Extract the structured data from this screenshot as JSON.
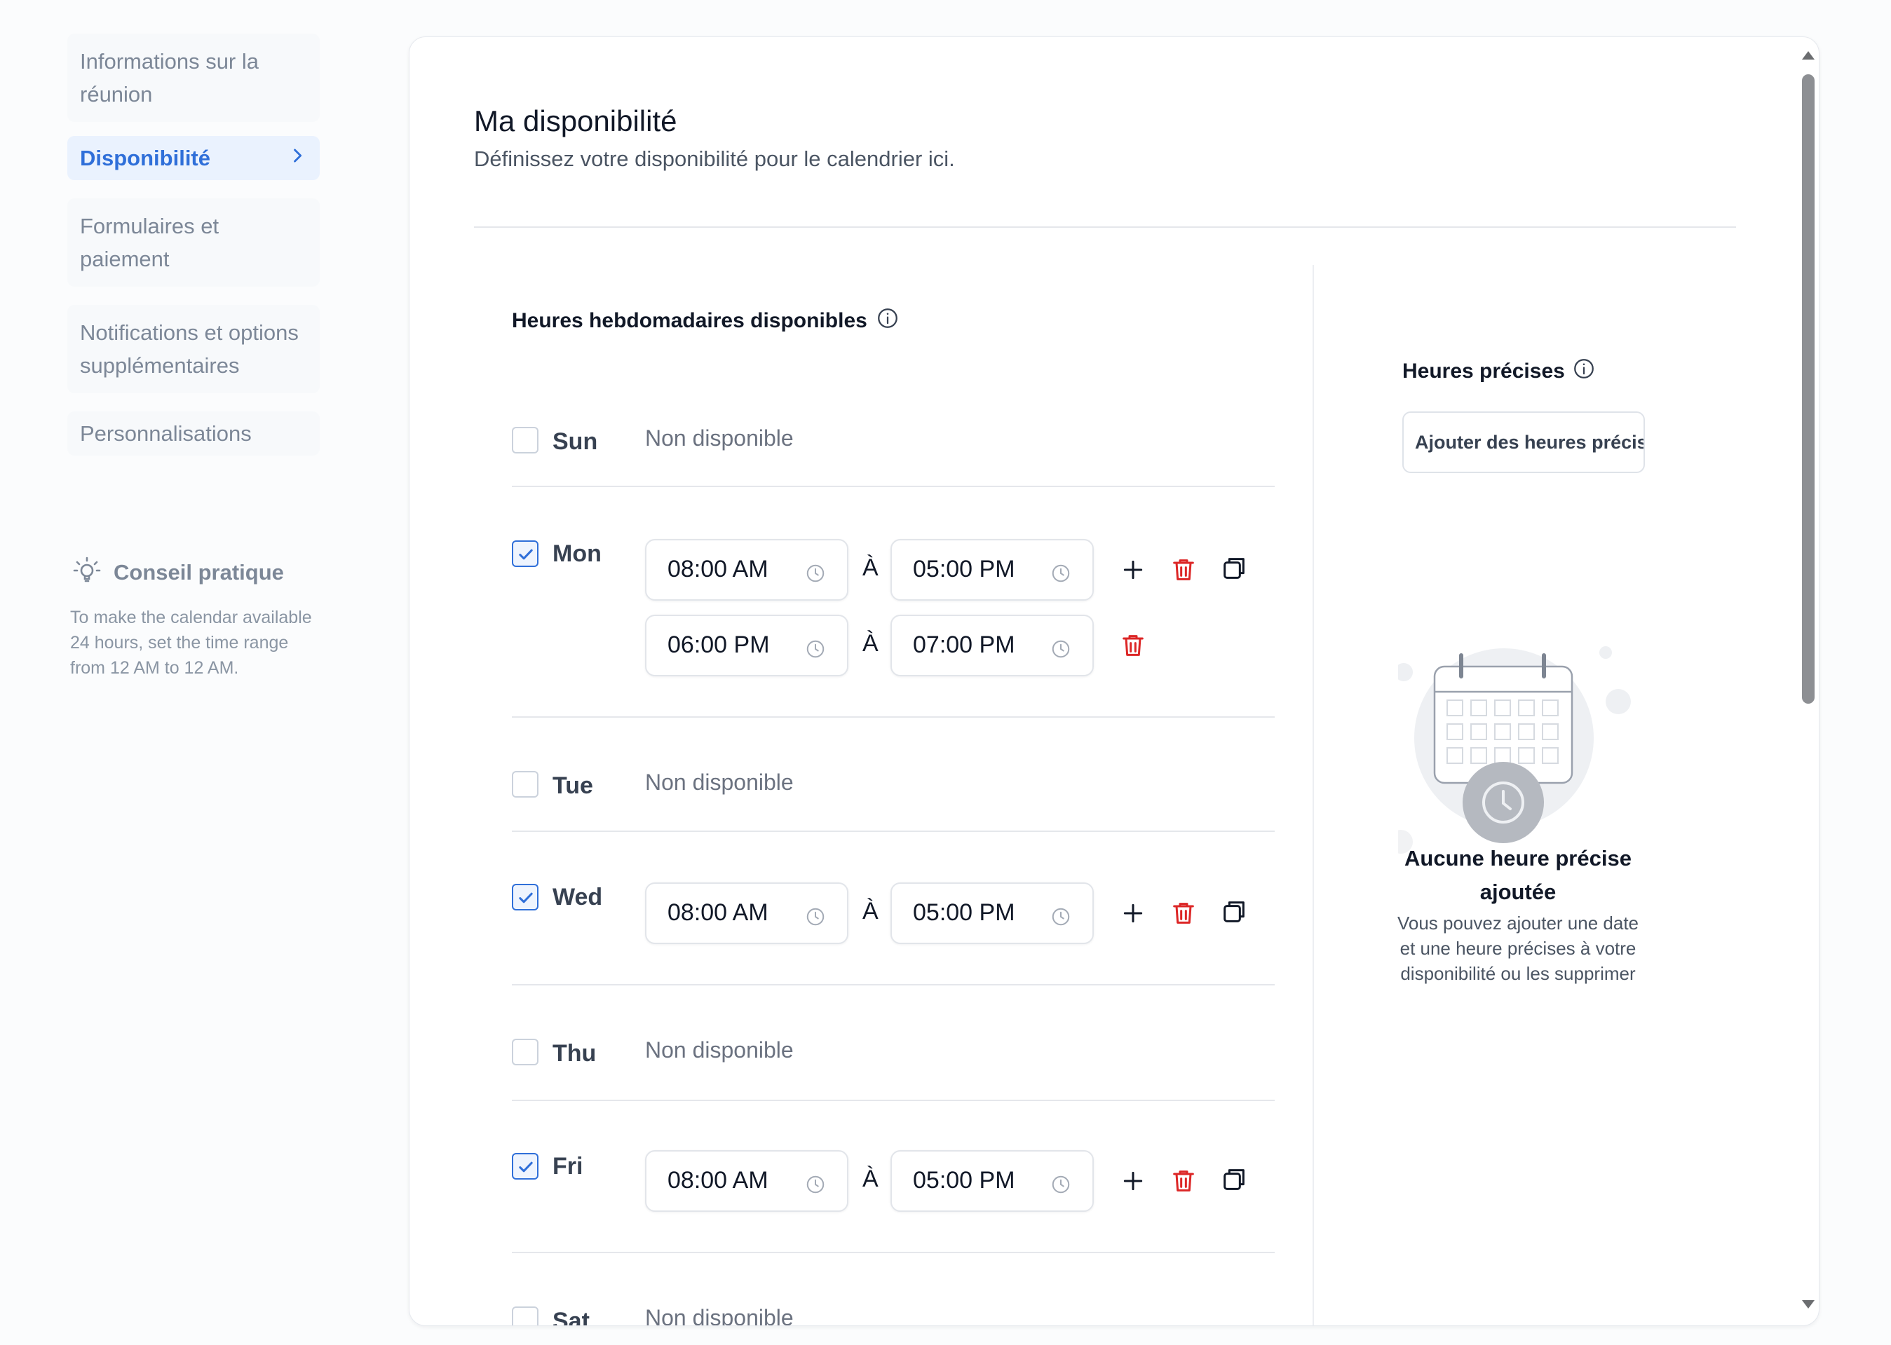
{
  "sidebar": {
    "items": [
      {
        "label": "Informations sur la réunion"
      },
      {
        "label": "Disponibilité"
      },
      {
        "label": "Formulaires et paiement"
      },
      {
        "label": "Notifications et options supplémentaires"
      },
      {
        "label": "Personnalisations"
      }
    ],
    "tip": {
      "title": "Conseil pratique",
      "text": "To make the calendar available 24 hours, set the time range from 12 AM to 12 AM."
    }
  },
  "main": {
    "title": "Ma disponibilité",
    "subtitle": "Définissez votre disponibilité pour le calendrier ici.",
    "weekly": {
      "title": "Heures hebdomadaires disponibles",
      "separator": "À",
      "unavailable_text": "Non disponible",
      "days": [
        {
          "label": "Sun",
          "checked": false
        },
        {
          "label": "Mon",
          "checked": true,
          "slots": [
            {
              "from": "08:00 AM",
              "to": "05:00 PM"
            },
            {
              "from": "06:00 PM",
              "to": "07:00 PM"
            }
          ]
        },
        {
          "label": "Tue",
          "checked": false
        },
        {
          "label": "Wed",
          "checked": true,
          "slots": [
            {
              "from": "08:00 AM",
              "to": "05:00 PM"
            }
          ]
        },
        {
          "label": "Thu",
          "checked": false
        },
        {
          "label": "Fri",
          "checked": true,
          "slots": [
            {
              "from": "08:00 AM",
              "to": "05:00 PM"
            }
          ]
        },
        {
          "label": "Sat",
          "checked": false
        }
      ]
    },
    "specific": {
      "title": "Heures précises",
      "add_button": "Ajouter des heures précises",
      "empty_title": "Aucune heure précise ajoutée",
      "empty_desc": "Vous pouvez ajouter une date et une heure précises à votre disponibilité ou les supprimer"
    }
  },
  "colors": {
    "accent": "#2f6fd9",
    "delete": "#dc2626",
    "active_bg": "#eaf2fe"
  }
}
